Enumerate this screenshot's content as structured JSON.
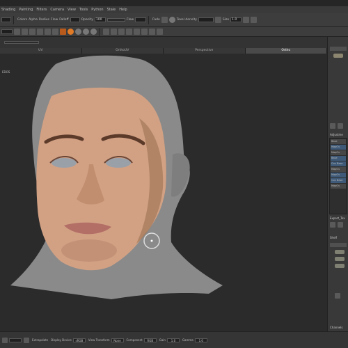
{
  "menu": {
    "items": [
      "Shading",
      "Painting",
      "Filters",
      "Camera",
      "View",
      "Tools",
      "Python",
      "Stale",
      "Help"
    ]
  },
  "toolbar1": {
    "colors_label": "Colors",
    "alpha_label": "Alpha",
    "radius_label": "Radius",
    "flow_label": "Flow",
    "fallof_label": "Falloff",
    "opacity_label": "Opacity",
    "fade_label": "Fade",
    "flow_field_label": "Flow",
    "texel_density_label": "Texel density",
    "size_label": "Size",
    "opacity_value": "100",
    "size_value": "1.0"
  },
  "viewport": {
    "tabs": [
      "UV",
      "OrthoUV",
      "Perspective",
      "Ortho"
    ],
    "active_tab": "Ortho",
    "corner_label": "EDOS"
  },
  "right_panel": {
    "top_label": "Name",
    "layers_title": "Adjustme",
    "layers": [
      "Base",
      "MapOv",
      "MapOv",
      "Base",
      "Con Base",
      "MapOv",
      "MapOv",
      "Con Base",
      "MapOv"
    ],
    "shelf_label": "Export_Tex",
    "lower_title": "Shelf",
    "lower_name": "Name",
    "channels_label": "Channels"
  },
  "statusbar": {
    "items": [
      {
        "label": "Extrapolate",
        "value": ""
      },
      {
        "label": "Display Device",
        "value": "sRGB"
      },
      {
        "label": "View Transform",
        "value": "None"
      },
      {
        "label": "Component",
        "value": "RGB"
      },
      {
        "label": "Gain",
        "value": "1.0"
      },
      {
        "label": "Gamma",
        "value": "1.0"
      }
    ]
  }
}
